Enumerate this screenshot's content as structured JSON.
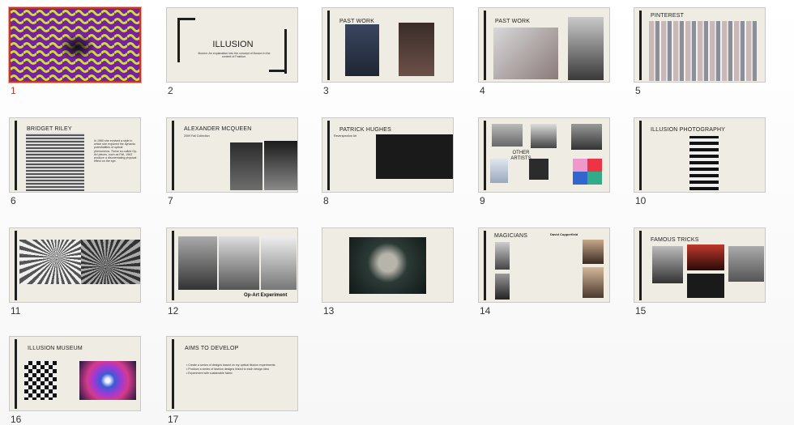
{
  "slides": [
    {
      "number": "1"
    },
    {
      "number": "2",
      "title": "ILLUSION",
      "subtitle": "Illusion: An explanation into the concept of illusion in the context of Fashion."
    },
    {
      "number": "3",
      "title": "PAST WORK"
    },
    {
      "number": "4",
      "title": "PAST WORK"
    },
    {
      "number": "5",
      "title": "PINTEREST"
    },
    {
      "number": "6",
      "title": "BRIDGET RILEY",
      "body": "In 1960 she evolved a style in which she explored the dynamic potentialities of optical phenomena. These so-called Op-Art pieces, such as Fall, 1963 produce a disorientating physical effect on the eye."
    },
    {
      "number": "7",
      "title": "ALEXANDER MCQUEEN",
      "caption": "2009 Fall Collection"
    },
    {
      "number": "8",
      "title": "PATRICK HUGHES",
      "body": "Reverspective Art"
    },
    {
      "number": "9",
      "title": "OTHER ARTISTS"
    },
    {
      "number": "10",
      "title": "ILLUSION PHOTOGRAPHY"
    },
    {
      "number": "11"
    },
    {
      "number": "12",
      "caption": "Op-Art Experiment"
    },
    {
      "number": "13"
    },
    {
      "number": "14",
      "title": "MAGICIANS",
      "caption": "David Copperfield"
    },
    {
      "number": "15",
      "title": "FAMOUS TRICKS"
    },
    {
      "number": "16",
      "title": "ILLUSION MUSEUM"
    },
    {
      "number": "17",
      "title": "AIMS TO DEVELOP",
      "bullets": [
        "Create a series of designs based on my optical illusion experiments",
        "Produce a series of fashion designs linked to each design idea",
        "Experiment with sustainable fabric"
      ]
    }
  ]
}
